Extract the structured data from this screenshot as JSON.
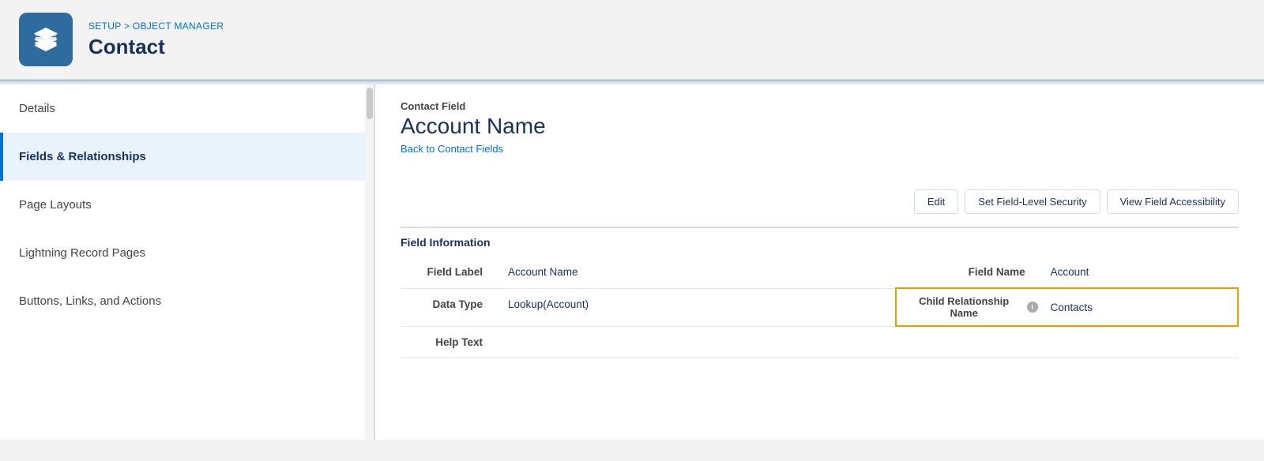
{
  "header": {
    "breadcrumb_setup": "SETUP",
    "breadcrumb_separator": " > ",
    "breadcrumb_manager": "OBJECT MANAGER",
    "title": "Contact"
  },
  "sidebar": {
    "items": [
      {
        "id": "details",
        "label": "Details",
        "active": false
      },
      {
        "id": "fields-relationships",
        "label": "Fields & Relationships",
        "active": true
      },
      {
        "id": "page-layouts",
        "label": "Page Layouts",
        "active": false
      },
      {
        "id": "lightning-record-pages",
        "label": "Lightning Record Pages",
        "active": false
      },
      {
        "id": "buttons-links-actions",
        "label": "Buttons, Links, and Actions",
        "active": false
      }
    ]
  },
  "content": {
    "field_label": "Contact Field",
    "field_title": "Account Name",
    "back_link": "Back to Contact Fields",
    "toolbar": {
      "edit_label": "Edit",
      "security_label": "Set Field-Level Security",
      "accessibility_label": "View Field Accessibility"
    },
    "section_title": "Field Information",
    "table": {
      "row1": {
        "label": "Field Label",
        "value": "Account Name",
        "field_name_label": "Field Name",
        "field_name_value": "Account"
      },
      "row2": {
        "label": "Data Type",
        "value": "Lookup(Account)",
        "child_rel_label": "Child Relationship Name",
        "child_rel_value": "Contacts",
        "info_icon": "i"
      },
      "row3": {
        "label": "Help Text"
      }
    }
  },
  "icons": {
    "layers": "layers-icon"
  }
}
